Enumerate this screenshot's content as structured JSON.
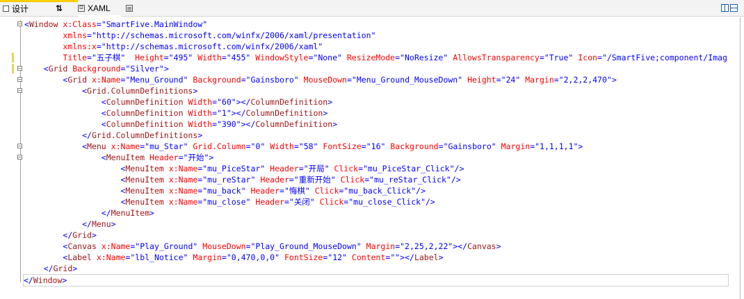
{
  "toolbar": {
    "design_tab": "设计",
    "swap_glyph": "⇅",
    "xaml_tab": "XAML"
  },
  "editor": {
    "lines": [
      [
        [
          "b",
          "<"
        ],
        [
          "t",
          "Window"
        ],
        [
          "e",
          " "
        ],
        [
          "a",
          "x:Class"
        ],
        [
          "b",
          "=\"SmartFive.MainWindow\""
        ]
      ],
      [
        [
          "e",
          "        "
        ],
        [
          "a",
          "xmlns"
        ],
        [
          "b",
          "=\"http://schemas.microsoft.com/winfx/2006/xaml/presentation\""
        ]
      ],
      [
        [
          "e",
          "        "
        ],
        [
          "a",
          "xmlns:x"
        ],
        [
          "b",
          "=\"http://schemas.microsoft.com/winfx/2006/xaml\""
        ]
      ],
      [
        [
          "e",
          "        "
        ],
        [
          "a",
          "Title"
        ],
        [
          "b",
          "=\"五子棋\""
        ],
        [
          "e",
          "  "
        ],
        [
          "a",
          "Height"
        ],
        [
          "b",
          "=\"495\""
        ],
        [
          "e",
          " "
        ],
        [
          "a",
          "Width"
        ],
        [
          "b",
          "=\"455\""
        ],
        [
          "e",
          " "
        ],
        [
          "a",
          "WindowStyle"
        ],
        [
          "b",
          "=\"None\""
        ],
        [
          "e",
          " "
        ],
        [
          "a",
          "ResizeMode"
        ],
        [
          "b",
          "=\"NoResize\""
        ],
        [
          "e",
          " "
        ],
        [
          "a",
          "AllowsTransparency"
        ],
        [
          "b",
          "=\"True\""
        ],
        [
          "e",
          " "
        ],
        [
          "a",
          "Icon"
        ],
        [
          "b",
          "=\"/SmartFive;component/Imag"
        ]
      ],
      [
        [
          "e",
          "    "
        ],
        [
          "b",
          "<"
        ],
        [
          "t",
          "Grid"
        ],
        [
          "e",
          " "
        ],
        [
          "a",
          "Background"
        ],
        [
          "b",
          "=\"Silver\">"
        ]
      ],
      [
        [
          "e",
          "        "
        ],
        [
          "b",
          "<"
        ],
        [
          "t",
          "Grid"
        ],
        [
          "e",
          " "
        ],
        [
          "a",
          "x:Name"
        ],
        [
          "b",
          "=\"Menu_Ground\""
        ],
        [
          "e",
          " "
        ],
        [
          "a",
          "Background"
        ],
        [
          "b",
          "=\"Gainsboro\""
        ],
        [
          "e",
          " "
        ],
        [
          "a",
          "MouseDown"
        ],
        [
          "b",
          "=\"Menu_Ground_MouseDown\""
        ],
        [
          "e",
          " "
        ],
        [
          "a",
          "Height"
        ],
        [
          "b",
          "=\"24\""
        ],
        [
          "e",
          " "
        ],
        [
          "a",
          "Margin"
        ],
        [
          "b",
          "=\"2,2,2,470\">"
        ]
      ],
      [
        [
          "e",
          "            "
        ],
        [
          "b",
          "<"
        ],
        [
          "t",
          "Grid.ColumnDefinitions"
        ],
        [
          "b",
          ">"
        ]
      ],
      [
        [
          "e",
          "                "
        ],
        [
          "b",
          "<"
        ],
        [
          "t",
          "ColumnDefinition"
        ],
        [
          "e",
          " "
        ],
        [
          "a",
          "Width"
        ],
        [
          "b",
          "=\"60\"></"
        ],
        [
          "t",
          "ColumnDefinition"
        ],
        [
          "b",
          ">"
        ]
      ],
      [
        [
          "e",
          "                "
        ],
        [
          "b",
          "<"
        ],
        [
          "t",
          "ColumnDefinition"
        ],
        [
          "e",
          " "
        ],
        [
          "a",
          "Width"
        ],
        [
          "b",
          "=\"1\"></"
        ],
        [
          "t",
          "ColumnDefinition"
        ],
        [
          "b",
          ">"
        ]
      ],
      [
        [
          "e",
          "                "
        ],
        [
          "b",
          "<"
        ],
        [
          "t",
          "ColumnDefinition"
        ],
        [
          "e",
          " "
        ],
        [
          "a",
          "Width"
        ],
        [
          "b",
          "=\"390\"></"
        ],
        [
          "t",
          "ColumnDefinition"
        ],
        [
          "b",
          ">"
        ]
      ],
      [
        [
          "e",
          "            "
        ],
        [
          "b",
          "</"
        ],
        [
          "t",
          "Grid.ColumnDefinitions"
        ],
        [
          "b",
          ">"
        ]
      ],
      [
        [
          "e",
          "            "
        ],
        [
          "b",
          "<"
        ],
        [
          "t",
          "Menu"
        ],
        [
          "e",
          " "
        ],
        [
          "a",
          "x:Name"
        ],
        [
          "b",
          "=\"mu_Star\""
        ],
        [
          "e",
          " "
        ],
        [
          "a",
          "Grid.Column"
        ],
        [
          "b",
          "=\"0\""
        ],
        [
          "e",
          " "
        ],
        [
          "a",
          "Width"
        ],
        [
          "b",
          "=\"58\""
        ],
        [
          "e",
          " "
        ],
        [
          "a",
          "FontSize"
        ],
        [
          "b",
          "=\"16\""
        ],
        [
          "e",
          " "
        ],
        [
          "a",
          "Background"
        ],
        [
          "b",
          "=\"Gainsboro\""
        ],
        [
          "e",
          " "
        ],
        [
          "a",
          "Margin"
        ],
        [
          "b",
          "=\"1,1,1,1\">"
        ]
      ],
      [
        [
          "e",
          "                "
        ],
        [
          "b",
          "<"
        ],
        [
          "t",
          "MenuItem"
        ],
        [
          "e",
          " "
        ],
        [
          "a",
          "Header"
        ],
        [
          "b",
          "=\"开始\">"
        ]
      ],
      [
        [
          "e",
          "                    "
        ],
        [
          "b",
          "<"
        ],
        [
          "t",
          "MenuItem"
        ],
        [
          "e",
          " "
        ],
        [
          "a",
          "x:Name"
        ],
        [
          "b",
          "=\"mu_PiceStar\""
        ],
        [
          "e",
          " "
        ],
        [
          "a",
          "Header"
        ],
        [
          "b",
          "=\"开局\""
        ],
        [
          "e",
          " "
        ],
        [
          "a",
          "Click"
        ],
        [
          "b",
          "=\"mu_PiceStar_Click\"/>"
        ]
      ],
      [
        [
          "e",
          "                    "
        ],
        [
          "b",
          "<"
        ],
        [
          "t",
          "MenuItem"
        ],
        [
          "e",
          " "
        ],
        [
          "a",
          "x:Name"
        ],
        [
          "b",
          "=\"mu_reStar\""
        ],
        [
          "e",
          " "
        ],
        [
          "a",
          "Header"
        ],
        [
          "b",
          "=\"重新开始\""
        ],
        [
          "e",
          " "
        ],
        [
          "a",
          "Click"
        ],
        [
          "b",
          "=\"mu_reStar_Click\"/>"
        ]
      ],
      [
        [
          "e",
          "                    "
        ],
        [
          "b",
          "<"
        ],
        [
          "t",
          "MenuItem"
        ],
        [
          "e",
          " "
        ],
        [
          "a",
          "x:Name"
        ],
        [
          "b",
          "=\"mu_back\""
        ],
        [
          "e",
          " "
        ],
        [
          "a",
          "Header"
        ],
        [
          "b",
          "=\"悔棋\""
        ],
        [
          "e",
          " "
        ],
        [
          "a",
          "Click"
        ],
        [
          "b",
          "=\"mu_back_Click\"/>"
        ]
      ],
      [
        [
          "e",
          "                    "
        ],
        [
          "b",
          "<"
        ],
        [
          "t",
          "MenuItem"
        ],
        [
          "e",
          " "
        ],
        [
          "a",
          "x:Name"
        ],
        [
          "b",
          "=\"mu_close\""
        ],
        [
          "e",
          " "
        ],
        [
          "a",
          "Header"
        ],
        [
          "b",
          "=\"关闭\""
        ],
        [
          "e",
          " "
        ],
        [
          "a",
          "Click"
        ],
        [
          "b",
          "=\"mu_close_Click\"/>"
        ]
      ],
      [
        [
          "e",
          "                "
        ],
        [
          "b",
          "</"
        ],
        [
          "t",
          "MenuItem"
        ],
        [
          "b",
          ">"
        ]
      ],
      [
        [
          "e",
          "            "
        ],
        [
          "b",
          "</"
        ],
        [
          "t",
          "Menu"
        ],
        [
          "b",
          ">"
        ]
      ],
      [
        [
          "e",
          "        "
        ],
        [
          "b",
          "</"
        ],
        [
          "t",
          "Grid"
        ],
        [
          "b",
          ">"
        ]
      ],
      [
        [
          "e",
          "        "
        ],
        [
          "b",
          "<"
        ],
        [
          "t",
          "Canvas"
        ],
        [
          "e",
          " "
        ],
        [
          "a",
          "x:Name"
        ],
        [
          "b",
          "=\"Play_Ground\""
        ],
        [
          "e",
          " "
        ],
        [
          "a",
          "MouseDown"
        ],
        [
          "b",
          "=\"Play_Ground_MouseDown\""
        ],
        [
          "e",
          " "
        ],
        [
          "a",
          "Margin"
        ],
        [
          "b",
          "=\"2,25,2,22\"></"
        ],
        [
          "t",
          "Canvas"
        ],
        [
          "b",
          ">"
        ]
      ],
      [
        [
          "e",
          "        "
        ],
        [
          "b",
          "<"
        ],
        [
          "t",
          "Label"
        ],
        [
          "e",
          " "
        ],
        [
          "a",
          "x:Name"
        ],
        [
          "b",
          "=\"lbl_Notice\""
        ],
        [
          "e",
          " "
        ],
        [
          "a",
          "Margin"
        ],
        [
          "b",
          "=\"0,470,0,0\""
        ],
        [
          "e",
          " "
        ],
        [
          "a",
          "FontSize"
        ],
        [
          "b",
          "=\"12\""
        ],
        [
          "e",
          " "
        ],
        [
          "a",
          "Content"
        ],
        [
          "b",
          "=\"\"></"
        ],
        [
          "t",
          "Label"
        ],
        [
          "b",
          ">"
        ]
      ],
      [
        [
          "e",
          "    "
        ],
        [
          "b",
          "</"
        ],
        [
          "t",
          "Grid"
        ],
        [
          "b",
          ">"
        ]
      ],
      [
        [
          "b",
          "</"
        ],
        [
          "t",
          "Window"
        ],
        [
          "b",
          ">"
        ]
      ]
    ],
    "fold_lines": [
      0,
      4,
      5,
      6,
      11,
      12
    ],
    "changed_lines": [
      3,
      4
    ]
  }
}
